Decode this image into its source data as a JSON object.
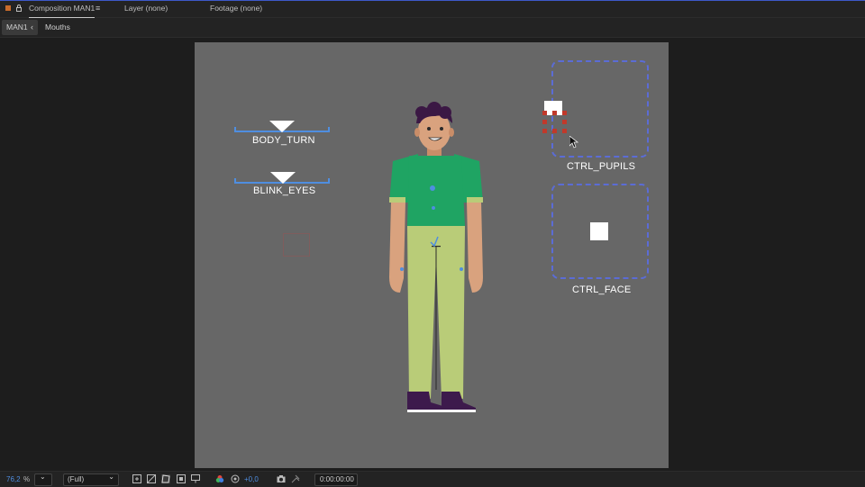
{
  "panel": {
    "comp_tab": "Composition MAN1",
    "layer_tab": "Layer (none)",
    "footage_tab": "Footage (none)"
  },
  "breadcrumbs": [
    "MAN1",
    "Mouths"
  ],
  "controls": {
    "body_turn": "BODY_TURN",
    "blink_eyes": "BLINK_EYES",
    "ctrl_pupils": "CTRL_PUPILS",
    "ctrl_face": "CTRL_FACE"
  },
  "statusbar": {
    "zoom_value": "76,2",
    "zoom_unit": "%",
    "resolution": "(Full)",
    "exposure": "+0,0",
    "timecode": "0:00:00:00"
  },
  "colors": {
    "accent": "#3d58c9",
    "background": "#676767",
    "shirt": "#1fa463",
    "pants": "#b9cc78",
    "skin": "#d9a27e",
    "hair": "#3b1844",
    "shoes": "#3d1a4c",
    "control_box": "#5b6cd6",
    "slider": "#4f8ee0"
  }
}
